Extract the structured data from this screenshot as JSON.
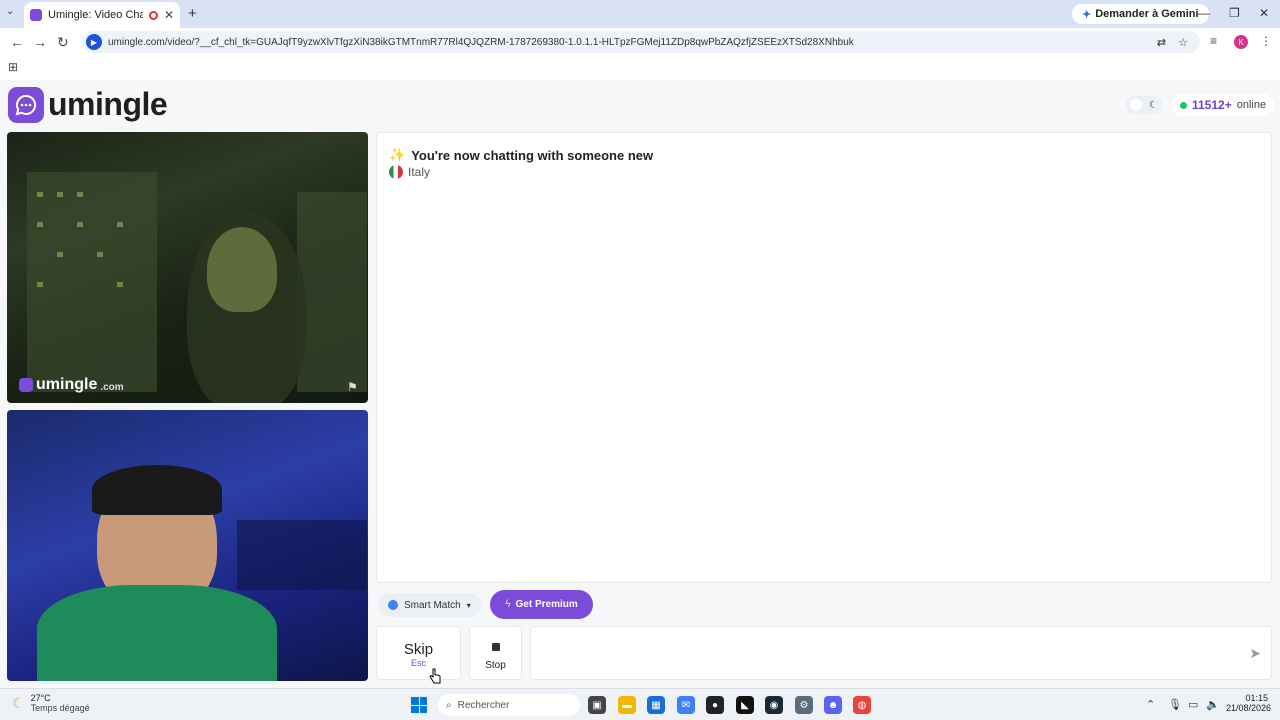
{
  "browser": {
    "tab_title": "Umingle: Video Chat with S",
    "new_tab_symbol": "+",
    "gemini_label": "Demander à Gemini",
    "url": "umingle.com/video/?__cf_chl_tk=GUAJqfT9yzwXlvTfgzXiN38ikGTMTnmR77Rl4QJQZRM-1787269380-1.0.1.1-HLTpzFGMej11ZDp8qwPbZAQzfjZSEEzXTSd28XNhbuk",
    "profile_initial": "K"
  },
  "site": {
    "logo_text": "umingle",
    "online_count": "11512+",
    "online_label": "online"
  },
  "video": {
    "watermark_text": "umingle",
    "watermark_suffix": ".com"
  },
  "chat": {
    "status_emoji": "✨",
    "status_message": "You're now chatting with someone new",
    "country": "Italy"
  },
  "controls": {
    "smart_match_label": "Smart Match",
    "premium_label": "Get Premium",
    "skip_label": "Skip",
    "skip_shortcut": "Esc",
    "stop_label": "Stop"
  },
  "taskbar": {
    "temperature": "27°C",
    "weather_desc": "Temps dégagé",
    "search_placeholder": "Rechercher",
    "time": "01:15",
    "date": "21/08/2026"
  },
  "colors": {
    "brand_purple": "#7b4bd9",
    "online_green": "#22c55e"
  }
}
